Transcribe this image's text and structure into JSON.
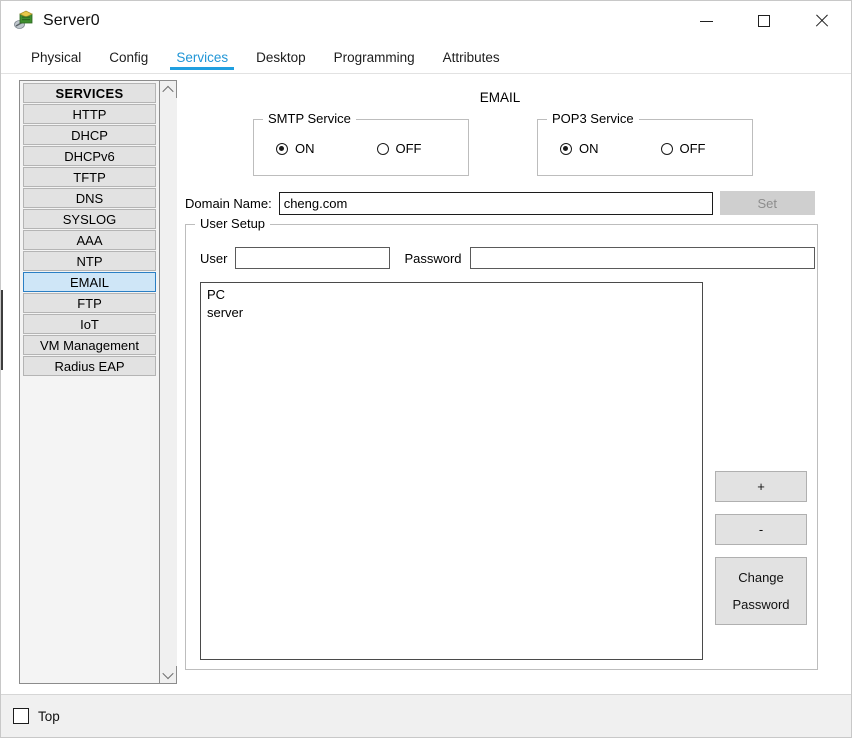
{
  "window": {
    "title": "Server0",
    "icon": "server-device-icon",
    "controls": {
      "minimize": "minimize-icon",
      "maximize": "maximize-icon",
      "close": "close-icon"
    }
  },
  "tabs": [
    {
      "label": "Physical",
      "active": false
    },
    {
      "label": "Config",
      "active": false
    },
    {
      "label": "Services",
      "active": true
    },
    {
      "label": "Desktop",
      "active": false
    },
    {
      "label": "Programming",
      "active": false
    },
    {
      "label": "Attributes",
      "active": false
    }
  ],
  "sidebar": {
    "header": "SERVICES",
    "items": [
      {
        "label": "HTTP",
        "selected": false
      },
      {
        "label": "DHCP",
        "selected": false
      },
      {
        "label": "DHCPv6",
        "selected": false
      },
      {
        "label": "TFTP",
        "selected": false
      },
      {
        "label": "DNS",
        "selected": false
      },
      {
        "label": "SYSLOG",
        "selected": false
      },
      {
        "label": "AAA",
        "selected": false
      },
      {
        "label": "NTP",
        "selected": false
      },
      {
        "label": "EMAIL",
        "selected": true
      },
      {
        "label": "FTP",
        "selected": false
      },
      {
        "label": "IoT",
        "selected": false
      },
      {
        "label": "VM Management",
        "selected": false
      },
      {
        "label": "Radius EAP",
        "selected": false
      }
    ],
    "scrollbar": {
      "up_icon": "chevron-up-icon",
      "down_icon": "chevron-down-icon"
    }
  },
  "main": {
    "page_title": "EMAIL",
    "smtp": {
      "legend": "SMTP Service",
      "on_label": "ON",
      "off_label": "OFF",
      "selected": "ON"
    },
    "pop3": {
      "legend": "POP3 Service",
      "on_label": "ON",
      "off_label": "OFF",
      "selected": "ON"
    },
    "domain": {
      "label": "Domain Name:",
      "value": "cheng.com",
      "placeholder": "",
      "set_button": "Set",
      "set_button_enabled": false
    },
    "user_setup": {
      "legend": "User Setup",
      "user_label": "User",
      "user_value": "",
      "user_placeholder": "",
      "password_label": "Password",
      "password_value": "",
      "password_placeholder": "",
      "users": [
        {
          "name": "PC"
        },
        {
          "name": "server"
        }
      ],
      "buttons": {
        "add": "+",
        "remove": "-",
        "change_password_line1": "Change",
        "change_password_line2": "Password"
      }
    }
  },
  "statusbar": {
    "top_checkbox_label": "Top",
    "top_checkbox_checked": false
  },
  "colors": {
    "accent": "#1f9fe0",
    "tab_active_text": "#2196d6",
    "selection_bg": "#cfe6f7",
    "selection_border": "#2b7fc4",
    "panel_bg": "#f0f0f0",
    "button_bg": "#e2e2e2",
    "disabled_button_bg": "#cfcfcf",
    "disabled_button_text": "#8d8d8d"
  }
}
